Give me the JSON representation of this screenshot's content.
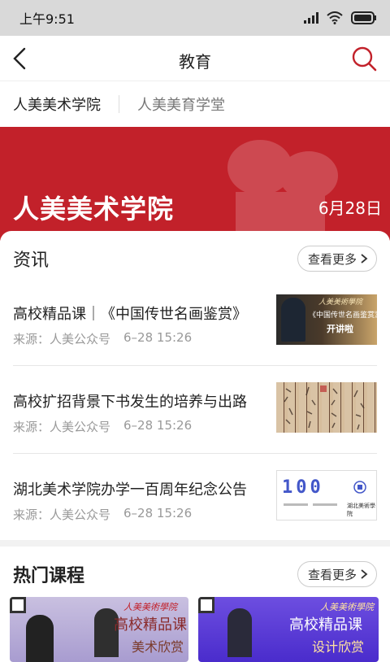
{
  "status_bar": {
    "time": "上午9:51"
  },
  "navbar": {
    "title": "教育"
  },
  "tabs": [
    {
      "label": "人美美术学院"
    },
    {
      "label": "人美美育学堂"
    }
  ],
  "banner": {
    "title": "人美美术学院",
    "date": "6月28日"
  },
  "news_section": {
    "title": "资讯",
    "more_label": "查看更多",
    "items": [
      {
        "title": "高校精品课｜《中国传世名画鉴赏》",
        "source": "来源：人美公众号",
        "time": "6–28 15:26",
        "thumb_caption_top": "人美美術學院",
        "thumb_caption_mid": "《中国传世名画鉴赏》",
        "thumb_caption_bottom": "开讲啦"
      },
      {
        "title": "高校扩招背景下书发生的培养与出路",
        "source": "来源：人美公众号",
        "time": "6–28 15:26"
      },
      {
        "title": "湖北美术学院办学一百周年纪念公告",
        "source": "来源：人美公众号",
        "time": "6–28 15:26",
        "thumb_caption_top": "100",
        "thumb_caption_bottom": "湖北美術學院"
      }
    ]
  },
  "hot_section": {
    "title": "热门课程",
    "more_label": "查看更多",
    "courses": [
      {
        "brand": "人美美術學院",
        "title": "高校精品课",
        "subtitle": "美术欣赏"
      },
      {
        "brand": "人美美術學院",
        "title": "高校精品课",
        "subtitle": "设计欣赏"
      }
    ]
  },
  "colors": {
    "accent": "#c2212a",
    "course_left_bg": "#b9aed8",
    "course_right_bg": "#5b3bd6"
  }
}
